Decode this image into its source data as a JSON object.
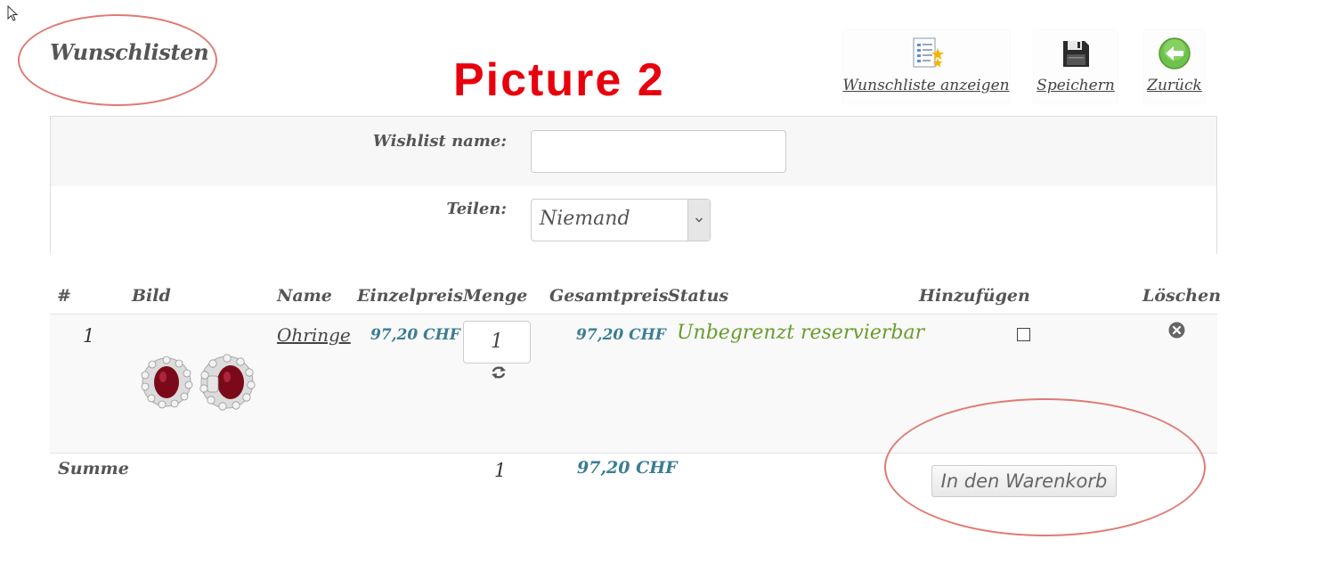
{
  "page": {
    "title": "Wunschlisten",
    "annotation": "Picture 2"
  },
  "toolbar": {
    "show_wishlist_label": "Wunschliste anzeigen",
    "save_label": "Speichern",
    "back_label": "Zurück",
    "icons": [
      "list-star-icon",
      "floppy-disk-icon",
      "back-arrow-icon"
    ]
  },
  "form": {
    "wishlist_name_label": "Wishlist name:",
    "wishlist_name_value": "",
    "share_label": "Teilen:",
    "share_selected": "Niemand"
  },
  "table": {
    "headers": [
      "#",
      "Bild",
      "Name",
      "Einzelpreis",
      "Menge",
      "Gesamtpreis",
      "Status",
      "Hinzufügen",
      "Löschen"
    ],
    "rows": [
      {
        "index": "1",
        "image": "ruby-earrings",
        "name": "Ohringe",
        "unit_price": "97,20 CHF",
        "quantity": "1",
        "total_price": "97,20 CHF",
        "status": "Unbegrenzt reservierbar",
        "add_checked": false
      }
    ],
    "summary": {
      "label": "Summe",
      "quantity": "1",
      "total": "97,20 CHF"
    }
  },
  "cart_button_label": "In den Warenkorb",
  "colors": {
    "annotation_red": "#e8000d",
    "ellipse": "#e07a74",
    "price": "#3a7d93",
    "status": "#6a9c2e"
  }
}
